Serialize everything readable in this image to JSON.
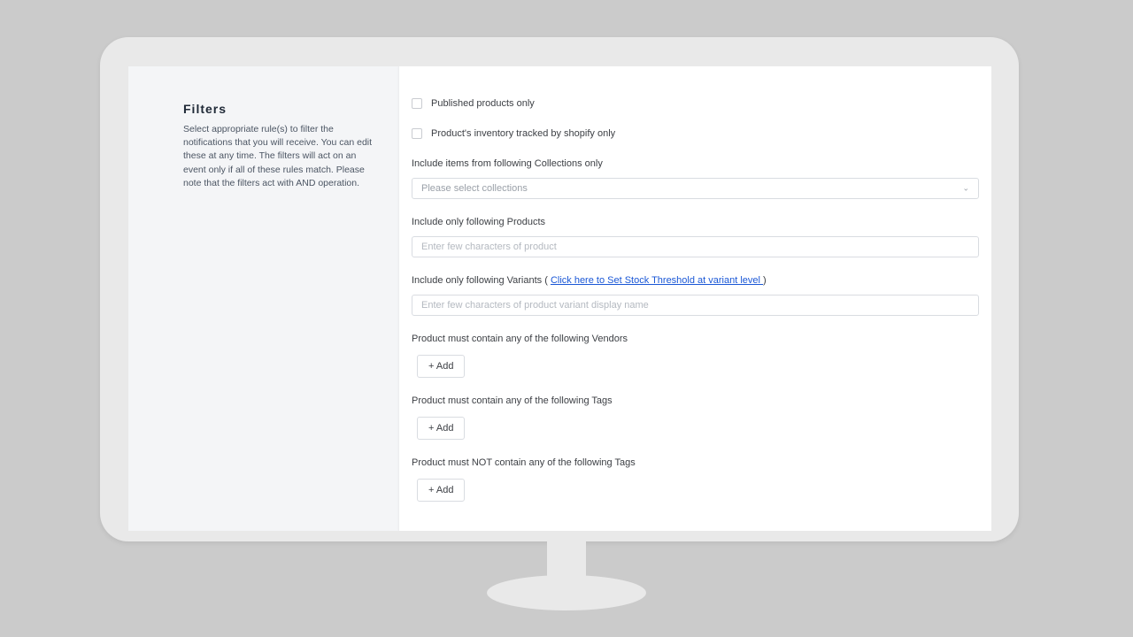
{
  "sidebar": {
    "title": "Filters",
    "description": "Select appropriate rule(s) to filter the notifications that you will receive. You can edit these at any time. The filters will act on an event only if all of these rules match. Please note that the filters act with AND operation."
  },
  "checks": {
    "published_only": "Published products only",
    "inventory_tracked": "Product's inventory tracked by shopify only"
  },
  "collections": {
    "label": "Include items from following Collections only",
    "placeholder": "Please select collections"
  },
  "products": {
    "label": "Include only following Products",
    "placeholder": "Enter few characters of product"
  },
  "variants": {
    "label_prefix": "Include only following Variants ( ",
    "link_text": "Click here to Set Stock Threshold at variant level ",
    "label_suffix": ")",
    "placeholder": "Enter few characters of product variant display name"
  },
  "vendors": {
    "label": "Product must contain any of the following Vendors",
    "add": "+ Add"
  },
  "tags_include": {
    "label": "Product must contain any of the following Tags",
    "add": "+ Add"
  },
  "tags_exclude": {
    "label": "Product must NOT contain any of the following Tags",
    "add": "+ Add"
  }
}
